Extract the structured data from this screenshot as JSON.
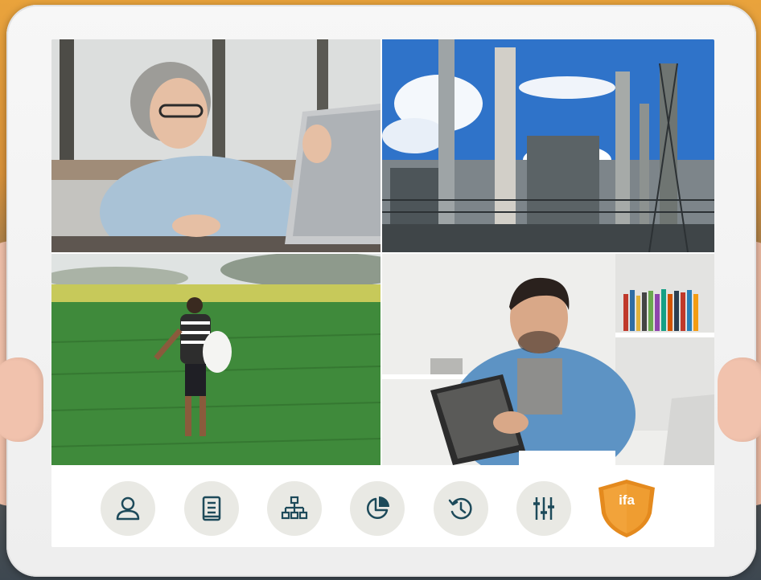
{
  "badge": {
    "text": "ifa"
  },
  "icons": [
    "user-icon",
    "book-icon",
    "org-chart-icon",
    "pie-chart-icon",
    "history-icon",
    "sliders-icon",
    "ifa-shield-badge"
  ],
  "colors": {
    "icon_stroke": "#1d4a5a",
    "icon_bg": "#e9e9e4",
    "badge_orange": "#f2a33a",
    "badge_dark": "#e48a1e"
  }
}
